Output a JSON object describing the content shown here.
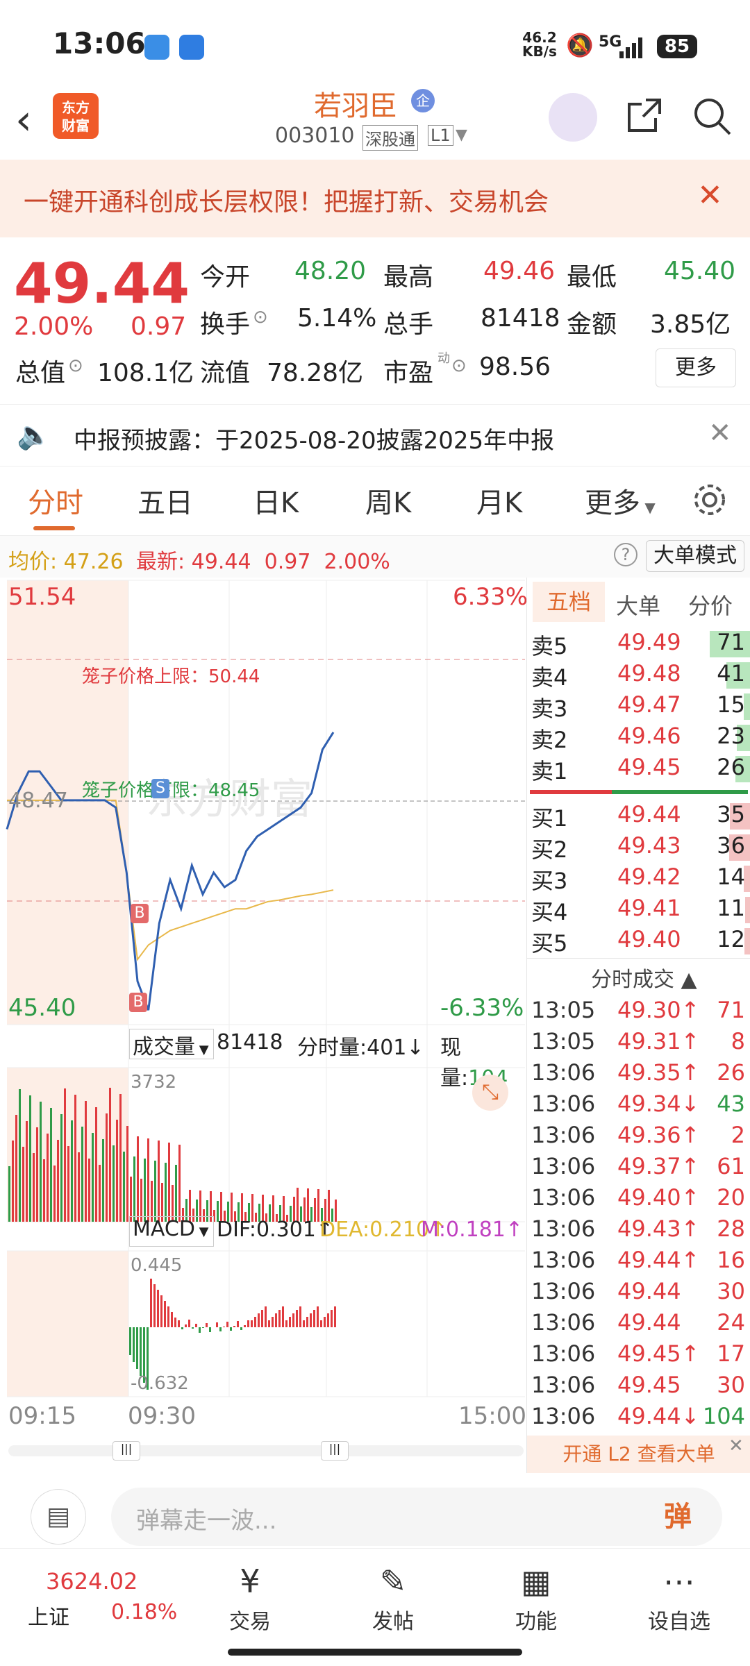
{
  "status": {
    "time": "13:06",
    "net_speed": "46.2",
    "net_unit": "KB/s",
    "network": "5G",
    "battery": "85"
  },
  "header": {
    "stock_name": "若羽臣",
    "badge": "企",
    "code": "003010",
    "exchange_tag": "深股通",
    "level_tag": "L1",
    "logo_line1": "东方",
    "logo_line2": "财富"
  },
  "banner": {
    "text": "一键开通科创成长层权限！把握打新、交易机会"
  },
  "quote": {
    "price": "49.44",
    "change_pct": "2.00%",
    "change": "0.97",
    "open_label": "今开",
    "open": "48.20",
    "high_label": "最高",
    "high": "49.46",
    "low_label": "最低",
    "low": "45.40",
    "turnover_label": "换手",
    "turnover": "5.14%",
    "volume_label": "总手",
    "volume": "81418",
    "amount_label": "金额",
    "amount": "3.85亿",
    "mktcap_label": "总值",
    "mktcap": "108.1亿",
    "float_label": "流值",
    "float": "78.28亿",
    "pe_label": "市盈",
    "pe_sup": "动",
    "pe": "98.56",
    "more": "更多"
  },
  "notice": {
    "text": "中报预披露：于2025-08-20披露2025年中报"
  },
  "tabs": [
    "分时",
    "五日",
    "日K",
    "周K",
    "月K",
    "更多"
  ],
  "infobar": {
    "avg_label": "均价:",
    "avg": "47.26",
    "last_label": "最新:",
    "last": "49.44",
    "chg": "0.97",
    "pct": "2.00%",
    "mode": "大单模式"
  },
  "chart": {
    "max_price": "51.54",
    "min_price": "45.40",
    "max_pct": "6.33%",
    "min_pct": "-6.33%",
    "prev_close": "48.47",
    "upper_limit": "笼子价格上限：50.44",
    "lower_limit": "笼子价格下限：48.45",
    "marker_s": "S",
    "marker_b": "B",
    "watermark": "东方财富",
    "vol_label": "成交量",
    "vol_total": "81418",
    "vol_min_label": "分时量:401↓",
    "vol_now_label": "现量:",
    "vol_now": "104",
    "vol_max": "3732",
    "macd_label": "MACD",
    "dif": "DIF:0.301↑",
    "dea": "DEA:0.210↑",
    "m": "M:0.181↑",
    "macd_max": "0.445",
    "macd_min": "-0.632",
    "t_start": "09:15",
    "t_open": "09:30",
    "t_end": "15:00"
  },
  "chart_data": {
    "type": "line",
    "x_label": "",
    "y_label": "",
    "y_range": [
      45.4,
      51.54
    ],
    "series": [
      {
        "values": [
          48.1,
          48.6,
          48.9,
          48.9,
          48.7,
          48.5,
          48.5,
          48.5,
          48.5,
          48.5,
          48.4,
          47.5,
          46.0,
          45.6,
          46.8,
          47.4,
          47.0,
          47.6,
          47.2,
          47.5,
          47.3,
          47.4,
          47.8,
          48.0,
          48.1,
          48.2,
          48.3,
          48.4,
          48.6,
          49.2,
          49.44
        ]
      },
      {
        "values": [
          48.5,
          48.5,
          48.5,
          48.5,
          48.5,
          48.5,
          48.5,
          48.5,
          48.5,
          48.5,
          48.5,
          47.5,
          46.3,
          46.5,
          46.6,
          46.7,
          46.75,
          46.8,
          46.85,
          46.9,
          46.95,
          47.0,
          47.0,
          47.05,
          47.1,
          47.12,
          47.15,
          47.18,
          47.2,
          47.23,
          47.26
        ]
      }
    ]
  },
  "book": {
    "tabs": [
      "五档",
      "大单",
      "分价"
    ],
    "sells": [
      {
        "l": "卖5",
        "p": "49.49",
        "v": "71",
        "w": 0.85
      },
      {
        "l": "卖4",
        "p": "49.48",
        "v": "41",
        "w": 0.5
      },
      {
        "l": "卖3",
        "p": "49.47",
        "v": "15",
        "w": 0.15
      },
      {
        "l": "卖2",
        "p": "49.46",
        "v": "23",
        "w": 0.28
      },
      {
        "l": "卖1",
        "p": "49.45",
        "v": "26",
        "w": 0.32
      }
    ],
    "buys": [
      {
        "l": "买1",
        "p": "49.44",
        "v": "35",
        "w": 0.43
      },
      {
        "l": "买2",
        "p": "49.43",
        "v": "36",
        "w": 0.45
      },
      {
        "l": "买3",
        "p": "49.42",
        "v": "14",
        "w": 0.15
      },
      {
        "l": "买4",
        "p": "49.41",
        "v": "11",
        "w": 0.12
      },
      {
        "l": "买5",
        "p": "49.40",
        "v": "12",
        "w": 0.13
      }
    ],
    "trades_title": "分时成交",
    "trades": [
      [
        "13:05",
        "49.30↑",
        "71"
      ],
      [
        "13:05",
        "49.31↑",
        "8"
      ],
      [
        "13:06",
        "49.35↑",
        "26"
      ],
      [
        "13:06",
        "49.34↓",
        "43"
      ],
      [
        "13:06",
        "49.36↑",
        "2"
      ],
      [
        "13:06",
        "49.37↑",
        "61"
      ],
      [
        "13:06",
        "49.40↑",
        "20"
      ],
      [
        "13:06",
        "49.43↑",
        "28"
      ],
      [
        "13:06",
        "49.44↑",
        "16"
      ],
      [
        "13:06",
        "49.44",
        "30"
      ],
      [
        "13:06",
        "49.44",
        "24"
      ],
      [
        "13:06",
        "49.45↑",
        "17"
      ],
      [
        "13:06",
        "49.45",
        "30"
      ],
      [
        "13:06",
        "49.44↓",
        "104"
      ]
    ],
    "l2": "开通 L2 查看大单"
  },
  "input": {
    "placeholder": "弹幕走一波...",
    "danmu": "弹"
  },
  "nav": {
    "index_value": "3624.02",
    "index_name": "上证",
    "index_pct": "0.18%",
    "items": [
      "交易",
      "发帖",
      "功能",
      "设自选"
    ]
  }
}
